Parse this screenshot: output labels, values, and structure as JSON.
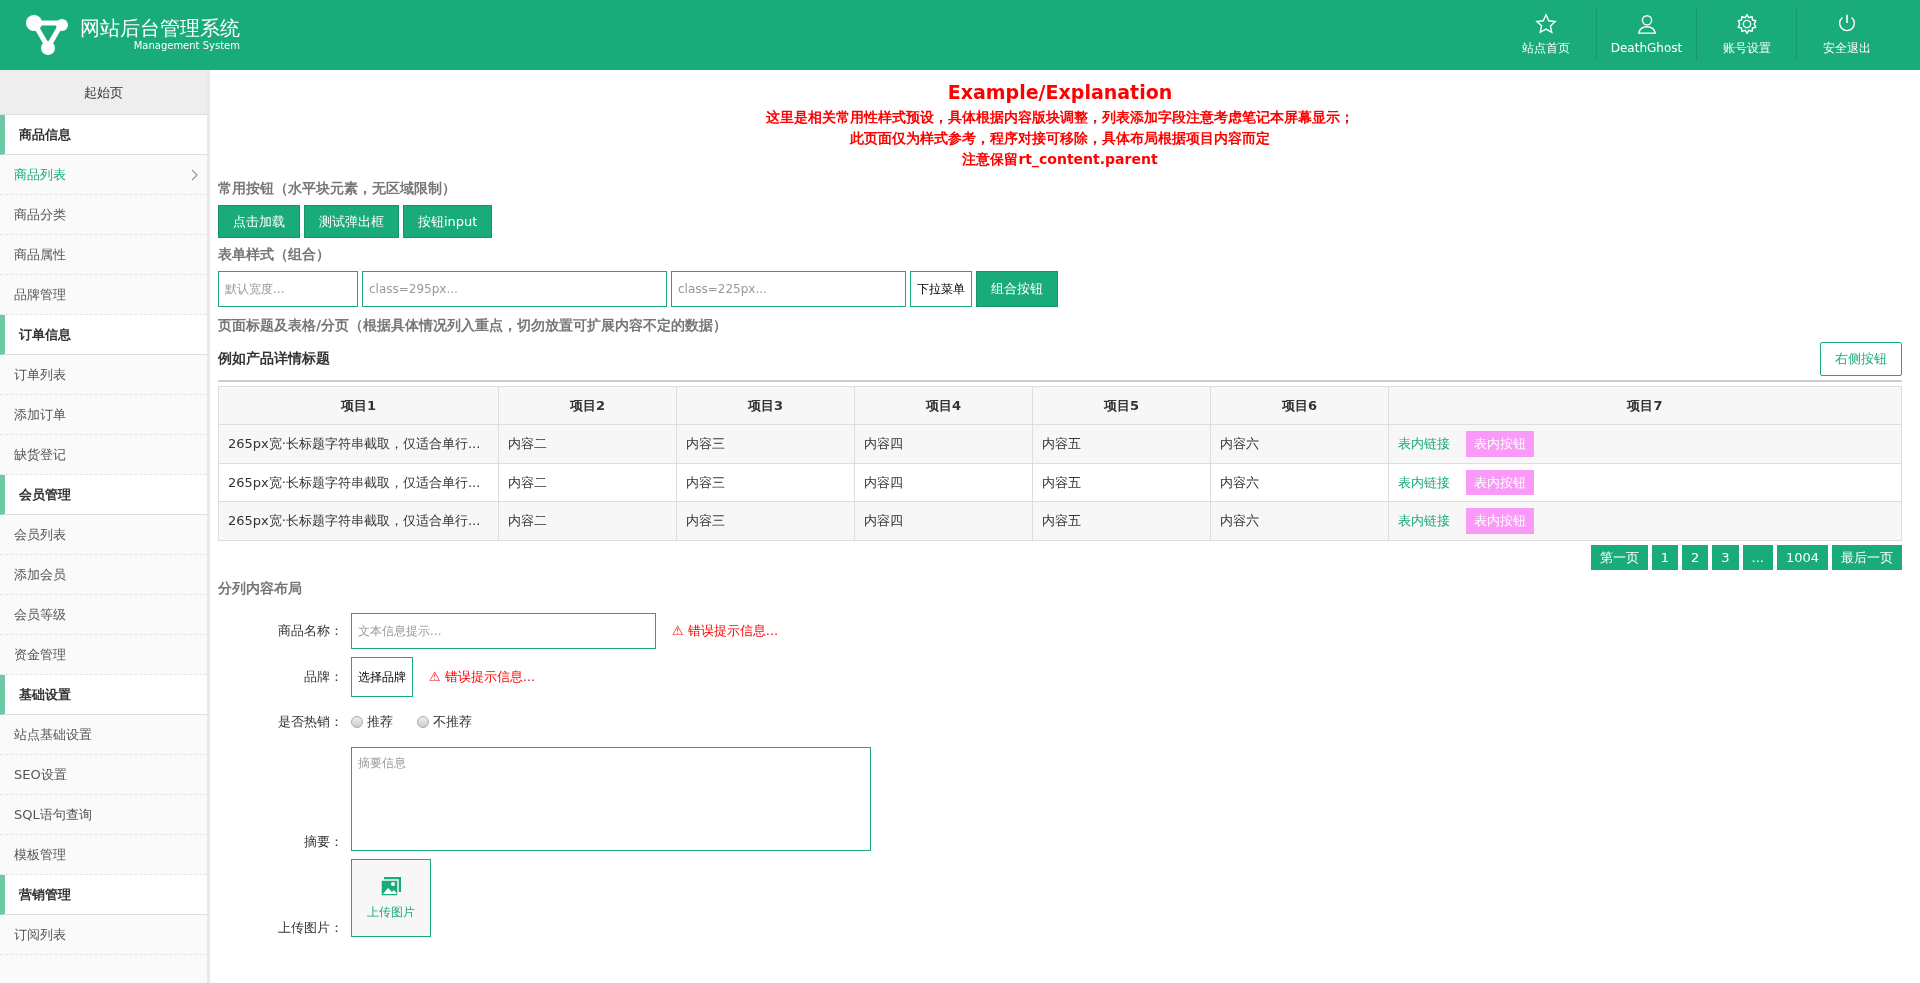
{
  "header": {
    "title": "网站后台管理系统",
    "subtitle": "Management System",
    "nav": [
      {
        "kind": "star",
        "label": "站点首页"
      },
      {
        "kind": "user",
        "label": "DeathGhost"
      },
      {
        "kind": "gear",
        "label": "账号设置"
      },
      {
        "kind": "power",
        "label": "安全退出"
      }
    ]
  },
  "sidebar": {
    "start": "起始页",
    "groups": [
      {
        "title": "商品信息",
        "items": [
          {
            "label": "商品列表",
            "selected": true
          },
          {
            "label": "商品分类",
            "selected": false
          },
          {
            "label": "商品属性",
            "selected": false
          },
          {
            "label": "品牌管理",
            "selected": false
          }
        ]
      },
      {
        "title": "订单信息",
        "items": [
          {
            "label": "订单列表",
            "selected": false
          },
          {
            "label": "添加订单",
            "selected": false
          },
          {
            "label": "缺货登记",
            "selected": false
          }
        ]
      },
      {
        "title": "会员管理",
        "items": [
          {
            "label": "会员列表",
            "selected": false
          },
          {
            "label": "添加会员",
            "selected": false
          },
          {
            "label": "会员等级",
            "selected": false
          },
          {
            "label": "资金管理",
            "selected": false
          }
        ]
      },
      {
        "title": "基础设置",
        "items": [
          {
            "label": "站点基础设置",
            "selected": false
          },
          {
            "label": "SEO设置",
            "selected": false
          },
          {
            "label": "SQL语句查询",
            "selected": false
          },
          {
            "label": "模板管理",
            "selected": false
          }
        ]
      },
      {
        "title": "营销管理",
        "items": [
          {
            "label": "订阅列表",
            "selected": false
          }
        ]
      }
    ]
  },
  "notice": {
    "title": "Example/Explanation",
    "lines": [
      "这里是相关常用性样式预设，具体根据内容版块调整，列表添加字段注意考虑笔记本屏幕显示；",
      "此页面仅为样式参考，程序对接可移除，具体布局根据项目内容而定",
      "注意保留rt_content.parent"
    ]
  },
  "buttons_section": {
    "heading": "常用按钮（水平块元素，无区域限制）",
    "buttons": [
      "点击加载",
      "测试弹出框",
      "按钮input"
    ]
  },
  "form_section": {
    "heading": "表单样式（组合）",
    "inputs": [
      {
        "placeholder": "默认宽度..."
      },
      {
        "placeholder": "class=295px..."
      },
      {
        "placeholder": "class=225px..."
      }
    ],
    "dropdown": "下拉菜单",
    "button": "组合按钮"
  },
  "table_section": {
    "heading": "页面标题及表格/分页（根据具体情况列入重点，切勿放置可扩展内容不定的数据）",
    "title": "例如产品详情标题",
    "right_button": "右侧按钮",
    "columns": [
      "项目1",
      "项目2",
      "项目3",
      "项目4",
      "项目5",
      "项目6",
      "项目7"
    ],
    "rows": [
      {
        "cells": [
          "265px宽·长标题字符串截取，仅适合单行...",
          "内容二",
          "内容三",
          "内容四",
          "内容五",
          "内容六"
        ],
        "link": "表内链接",
        "button": "表内按钮"
      },
      {
        "cells": [
          "265px宽·长标题字符串截取，仅适合单行...",
          "内容二",
          "内容三",
          "内容四",
          "内容五",
          "内容六"
        ],
        "link": "表内链接",
        "button": "表内按钮"
      },
      {
        "cells": [
          "265px宽·长标题字符串截取，仅适合单行...",
          "内容二",
          "内容三",
          "内容四",
          "内容五",
          "内容六"
        ],
        "link": "表内链接",
        "button": "表内按钮"
      }
    ],
    "pagination": [
      "第一页",
      "1",
      "2",
      "3",
      "...",
      "1004",
      "最后一页"
    ]
  },
  "layout_section": {
    "heading": "分列内容布局",
    "name_field": {
      "label": "商品名称：",
      "placeholder": "文本信息提示...",
      "error": "⚠ 错误提示信息..."
    },
    "brand_field": {
      "label": "品牌：",
      "button": "选择品牌",
      "error": "⚠ 错误提示信息..."
    },
    "hot_field": {
      "label": "是否热销：",
      "options": [
        {
          "label": "推荐",
          "checked": false
        },
        {
          "label": "不推荐",
          "checked": false
        }
      ]
    },
    "summary_field": {
      "label": "摘要：",
      "placeholder": "摘要信息"
    },
    "upload_field": {
      "label": "上传图片：",
      "button": "上传图片"
    }
  }
}
